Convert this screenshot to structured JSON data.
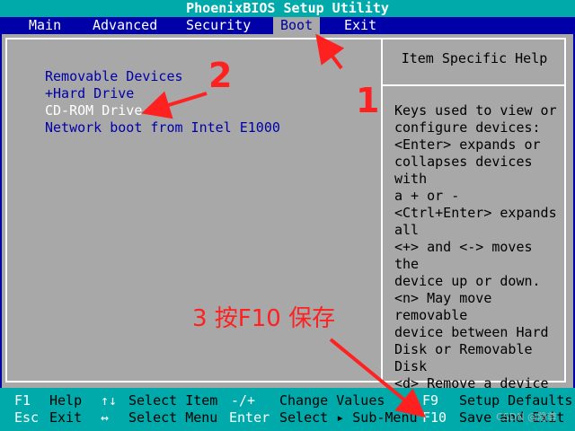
{
  "title": "PhoenixBIOS Setup Utility",
  "menu": [
    "Main",
    "Advanced",
    "Security",
    "Boot",
    "Exit"
  ],
  "boot_items": [
    "Removable Devices",
    "+Hard Drive",
    "CD-ROM Drive",
    "Network boot from Intel E1000"
  ],
  "help": {
    "title": "Item Specific Help",
    "text": "Keys used to view or\nconfigure devices:\n<Enter> expands or\ncollapses devices with\na + or -\n<Ctrl+Enter> expands\nall\n<+> and <-> moves the\ndevice up or down.\n<n> May move removable\ndevice between Hard\nDisk or Removable Disk\n<d> Remove a device\nthat is not installed."
  },
  "keys": {
    "f1": "F1",
    "help": "Help",
    "updown": "↑↓",
    "select_item": "Select Item",
    "minusplus": "-/+",
    "change_values": "Change Values",
    "f9": "F9",
    "setup_defaults": "Setup Defaults",
    "esc": "Esc",
    "exit": "Exit",
    "leftright": "↔",
    "select_menu": "Select Menu",
    "enter": "Enter",
    "select_submenu": "Select ▸ Sub-Menu",
    "f10": "F10",
    "save_exit": "Save and Exit"
  },
  "annotations": {
    "step1": "1",
    "step2": "2",
    "step3": "3 按F10 保存"
  },
  "watermark": "CSDN @隐尊"
}
